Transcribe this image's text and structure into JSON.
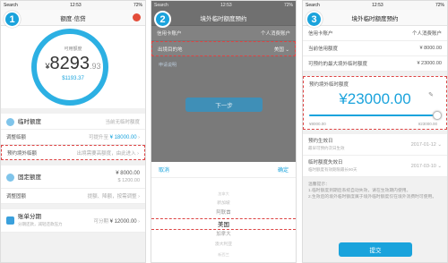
{
  "status_bar": {
    "carrier": "Search",
    "time": "12:53",
    "battery": "72%"
  },
  "screen1": {
    "step": "1",
    "title": "额度·信贷",
    "ring_label": "可用额度",
    "amount_symbol": "¥",
    "amount_int": "8293",
    "amount_dec": ".93",
    "amount_sub": "$1193.37",
    "temp_section": "临时额度",
    "temp_note": "当前无临时额度",
    "adjust_label": "调整临额",
    "adjust_hint": "可提升至",
    "adjust_value": "¥ 18000.00",
    "abroad_label": "预约境外临额",
    "abroad_hint": "出境需要高额度，由此进入",
    "fixed_section": "固定额度",
    "fixed_value": "¥ 8000.00",
    "fixed_sub": "$ 1200.00",
    "fixed_adjust": "调整固额",
    "fixed_adjust_hint": "提额、降额，按需调整",
    "installment_title": "账单分期",
    "installment_sub": "分期还款，减轻还款压力",
    "installment_hint": "可分期",
    "installment_value": "¥ 12000.00"
  },
  "screen2": {
    "step": "2",
    "title": "境外临时额度预约",
    "card_label": "信用卡账户",
    "card_value": "个人消费账户",
    "dest_label": "出境目的地",
    "dest_value": "美国",
    "link_text": "申请说明",
    "next": "下一步",
    "cancel": "取消",
    "confirm": "确定",
    "options": [
      "加拿大",
      "新加坡",
      "阿联酋",
      "美国",
      "加拿大",
      "澳大利亚",
      "新西兰"
    ],
    "selected_index": 3
  },
  "screen3": {
    "step": "3",
    "title": "境外临时额度预约",
    "card_label": "信用卡账户",
    "card_value": "个人消费账户",
    "current_label": "当前信用额度",
    "current_value": "¥ 8000.00",
    "max_label": "可预约的最大境外临时额度",
    "max_value": "¥ 23000.00",
    "slider_title": "预约境外临时额度",
    "slider_value": "¥23000.00",
    "slider_min": "¥8000.00",
    "slider_max": "¥23000.00",
    "slider_level": 1.0,
    "start_label": "预约生效日",
    "start_sub": "最早可预约次日生效",
    "start_value": "2017-01-12",
    "end_label": "临时额度失效日",
    "end_sub": "临时额度有效期限最长90天",
    "end_value": "2017-03-10",
    "notes_title": "温馨提示：",
    "notes": [
      "1.临时额度到期后系统自动失效，请在生效期内使用。",
      "2.生效后的境外临时额度属于境外临时额度仅在境外消费时可使用。"
    ],
    "submit": "提交"
  }
}
